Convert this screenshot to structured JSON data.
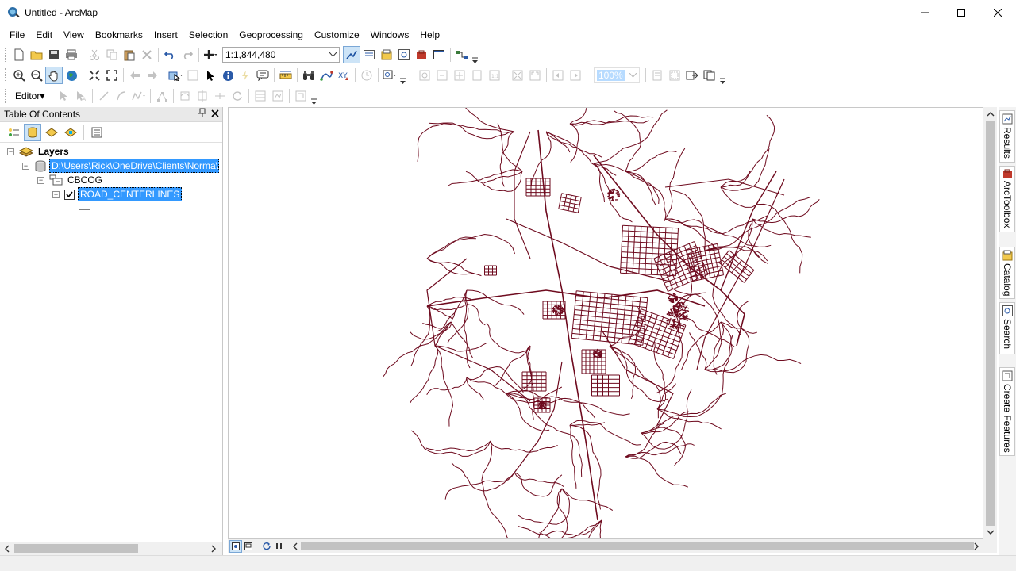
{
  "window": {
    "title": "Untitled - ArcMap"
  },
  "menu": [
    "File",
    "Edit",
    "View",
    "Bookmarks",
    "Insert",
    "Selection",
    "Geoprocessing",
    "Customize",
    "Windows",
    "Help"
  ],
  "toolbar": {
    "scale_value": "1:1,844,480",
    "editor_label": "Editor▾",
    "layer_select_value": "100%"
  },
  "toc": {
    "title": "Table Of Contents",
    "layers_label": "Layers",
    "datasource_path": "D:\\Users\\Rick\\OneDrive\\Clients\\Norma\\",
    "group_label": "CBCOG",
    "layer_label": "ROAD_CENTERLINES",
    "layer_checked": true
  },
  "dock": {
    "tabs": [
      "Results",
      "ArcToolbox",
      "Catalog",
      "Search",
      "Create Features"
    ]
  },
  "colors": {
    "road_color": "#6e0a1e",
    "selection": "#3399ff"
  }
}
